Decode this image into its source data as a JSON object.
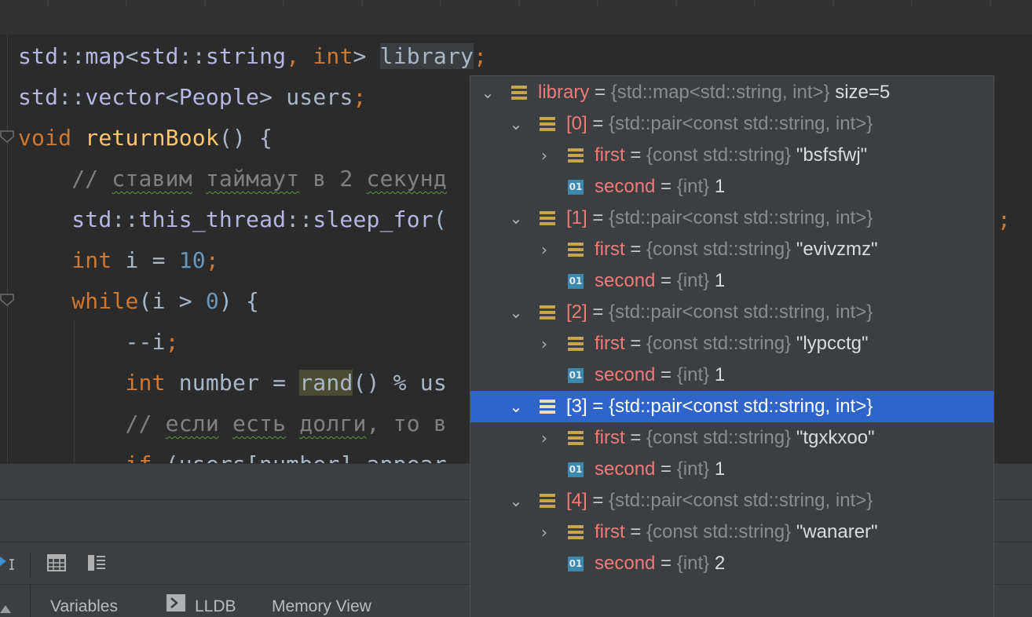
{
  "editor": {
    "lines": [
      [
        "std",
        "::",
        "map",
        "<",
        "std",
        "::",
        "string",
        ", ",
        "int",
        "> ",
        "library",
        ";"
      ],
      [
        "std",
        "::",
        "vector",
        "<",
        "People",
        "> ",
        "users",
        ";"
      ],
      [
        "void",
        " ",
        "returnBook",
        "() {"
      ],
      [
        "    ",
        "// ",
        "ставим",
        " ",
        "таймаут",
        " в 2 ",
        "секунд"
      ],
      [
        "    ",
        "std",
        "::",
        "this_thread",
        "::",
        "sleep_for",
        "("
      ],
      [
        "    ",
        "int",
        " i = ",
        "10",
        ";"
      ],
      [
        "    ",
        "while",
        "(i > ",
        "0",
        ") {"
      ],
      [
        "        ",
        "--i",
        ";"
      ],
      [
        "        ",
        "int",
        " number = ",
        "rand",
        "() % us"
      ],
      [
        "        ",
        "// ",
        "если",
        " ",
        "есть",
        " ",
        "долги",
        ", то в"
      ],
      [
        "        ",
        "if",
        " (users[number].appear"
      ]
    ],
    "line4_tail": ";"
  },
  "debug_tabs": {
    "variables": "Variables",
    "lldb": "LLDB",
    "memory_view": "Memory View"
  },
  "popup": {
    "root": {
      "name": "library",
      "eq": " = ",
      "type": "{std::map<std::string, int>}",
      "value": " size=5"
    },
    "entries": [
      {
        "name": "[0]",
        "type": "{std::pair<const std::string, int>}",
        "first_name": "first",
        "first_type": "{const std::string}",
        "first_value": "\"bsfsfwj\"",
        "second_name": "second",
        "second_type": "{int}",
        "second_value": "1"
      },
      {
        "name": "[1]",
        "type": "{std::pair<const std::string, int>}",
        "first_name": "first",
        "first_type": "{const std::string}",
        "first_value": "\"evivzmz\"",
        "second_name": "second",
        "second_type": "{int}",
        "second_value": "1"
      },
      {
        "name": "[2]",
        "type": "{std::pair<const std::string, int>}",
        "first_name": "first",
        "first_type": "{const std::string}",
        "first_value": "\"lypcctg\"",
        "second_name": "second",
        "second_type": "{int}",
        "second_value": "1"
      },
      {
        "name": "[3]",
        "type": "{std::pair<const std::string, int>}",
        "first_name": "first",
        "first_type": "{const std::string}",
        "first_value": "\"tgxkxoo\"",
        "second_name": "second",
        "second_type": "{int}",
        "second_value": "1"
      },
      {
        "name": "[4]",
        "type": "{std::pair<const std::string, int>}",
        "first_name": "first",
        "first_type": "{const std::string}",
        "first_value": "\"wanarer\"",
        "second_name": "second",
        "second_type": "{int}",
        "second_value": "2"
      }
    ],
    "eq": " = ",
    "prim_icon_label": "01",
    "selected_entry": "[3]"
  },
  "colors": {
    "editor_bg": "#2b2b2b",
    "popup_bg": "#3c3f41",
    "selection": "#2f65ca",
    "keyword": "#cc7832",
    "function": "#ffc66d",
    "number": "#6897bb",
    "var_name": "#f07a7a"
  },
  "icons": {
    "field": "field-icon",
    "primitive": "primitive-icon",
    "expand": "chevron-down-icon",
    "collapse": "chevron-right-icon",
    "table_view": "table-icon",
    "layout": "layout-icon",
    "lldb": "console-icon"
  }
}
